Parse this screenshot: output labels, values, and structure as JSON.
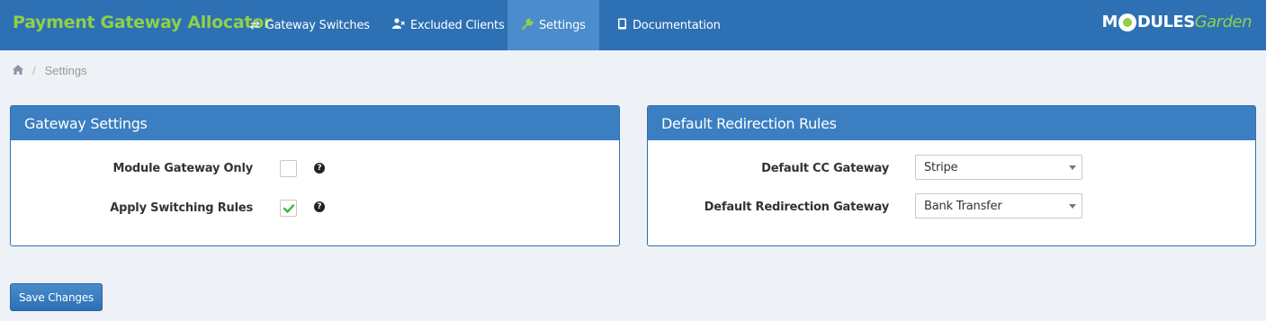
{
  "app": {
    "title": "Payment Gateway Allocator"
  },
  "nav": {
    "items": [
      {
        "label": "Gateway Switches",
        "icon": "refresh-icon",
        "active": false
      },
      {
        "label": "Excluded Clients",
        "icon": "user-x-icon",
        "active": false
      },
      {
        "label": "Settings",
        "icon": "wrench-icon",
        "active": true
      },
      {
        "label": "Documentation",
        "icon": "book-icon",
        "active": false
      }
    ],
    "logo": {
      "prefix": "M",
      "main": "DULES",
      "suffix": "Garden"
    }
  },
  "breadcrumb": {
    "home_icon": "home-icon",
    "current": "Settings"
  },
  "gateway_settings": {
    "title": "Gateway Settings",
    "fields": [
      {
        "label": "Module Gateway Only",
        "checked": false
      },
      {
        "label": "Apply Switching Rules",
        "checked": true
      }
    ]
  },
  "redirection_rules": {
    "title": "Default Redirection Rules",
    "fields": [
      {
        "label": "Default CC Gateway",
        "value": "Stripe"
      },
      {
        "label": "Default Redirection Gateway",
        "value": "Bank Transfer"
      }
    ]
  },
  "actions": {
    "save_label": "Save Changes"
  },
  "colors": {
    "navbar": "#2d70b3",
    "accent": "#8fd04a",
    "panel_header": "#3b7ec1",
    "background": "#eef1f6"
  }
}
